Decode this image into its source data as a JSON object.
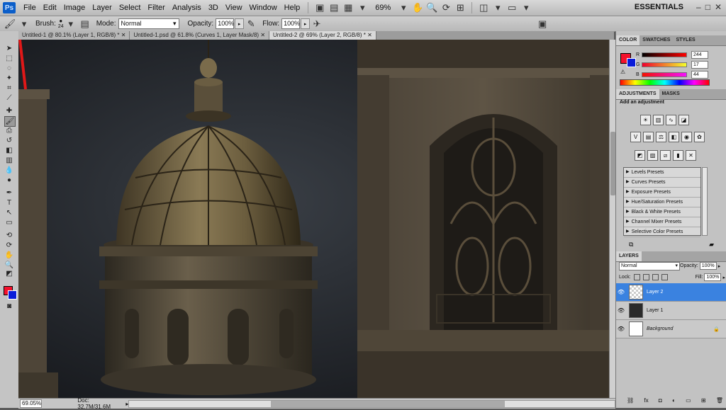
{
  "menubar": {
    "logo": "Ps",
    "items": [
      "File",
      "Edit",
      "Image",
      "Layer",
      "Select",
      "Filter",
      "Analysis",
      "3D",
      "View",
      "Window",
      "Help"
    ],
    "zoom": "69%",
    "workspace": "ESSENTIALS"
  },
  "options_bar": {
    "brush_label": "Brush:",
    "brush_size": "24",
    "mode_label": "Mode:",
    "mode_value": "Normal",
    "opacity_label": "Opacity:",
    "opacity_value": "100%",
    "flow_label": "Flow:",
    "flow_value": "100%"
  },
  "document_tabs": [
    "Untitled-1 @ 80.1% (Layer 1, RGB/8) *",
    "Untitled-1.psd @ 61.8% (Curves 1, Layer Mask/8)",
    "Untitled-2 @ 69% (Layer 2, RGB/8) *"
  ],
  "status_bar": {
    "zoom": "69.05%",
    "doc": "Doc: 32.7M/31.6M"
  },
  "color_panel": {
    "tabs": [
      "COLOR",
      "SWATCHES",
      "STYLES"
    ],
    "r_label": "R",
    "r_value": "244",
    "g_label": "G",
    "g_value": "17",
    "b_label": "B",
    "b_value": "44",
    "foreground_hex": "#f4112c",
    "background_hex": "#0a1cd9"
  },
  "adjustments_panel": {
    "tabs": [
      "ADJUSTMENTS",
      "MASKS"
    ],
    "title": "Add an adjustment",
    "presets": [
      "Levels Presets",
      "Curves Presets",
      "Exposure Presets",
      "Hue/Saturation Presets",
      "Black & White Presets",
      "Channel Mixer Presets",
      "Selective Color Presets"
    ]
  },
  "layers_panel": {
    "tab": "LAYERS",
    "blend_mode": "Normal",
    "opacity_label": "Opacity:",
    "opacity_value": "100%",
    "lock_label": "Lock:",
    "fill_label": "Fill:",
    "fill_value": "100%",
    "layers": [
      {
        "name": "Layer 2",
        "selected": true
      },
      {
        "name": "Layer 1",
        "selected": false
      },
      {
        "name": "Background",
        "selected": false
      }
    ]
  }
}
